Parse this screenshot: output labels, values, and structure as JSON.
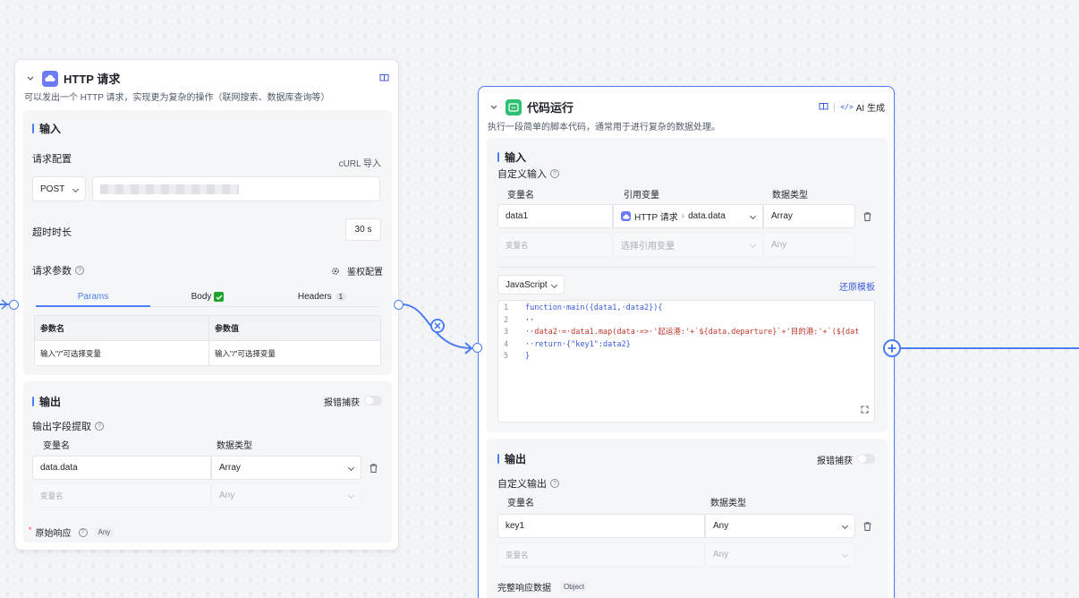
{
  "http_node": {
    "title": "HTTP 请求",
    "description": "可以发出一个 HTTP 请求，实现更为复杂的操作（联网搜索、数据库查询等）",
    "input": {
      "title": "输入",
      "request_config_label": "请求配置",
      "curl_import": "cURL 导入",
      "method": "POST",
      "timeout_label": "超时时长",
      "timeout_value": "30 s",
      "params_label": "请求参数",
      "auth_config": "鉴权配置",
      "tabs": {
        "params": "Params",
        "body": "Body",
        "headers": "Headers",
        "headers_count": "1"
      },
      "table": {
        "col_name": "参数名",
        "col_value": "参数值",
        "name_placeholder": "输入\"/\"可选择变量",
        "value_placeholder": "输入\"/\"可选择变量"
      }
    },
    "output": {
      "title": "输出",
      "error_catch": "报错捕获",
      "field_extract": "输出字段提取",
      "col_var": "变量名",
      "col_type": "数据类型",
      "row1_name": "data.data",
      "row1_type": "Array",
      "row2_name_placeholder": "变量名",
      "row2_type_placeholder": "Any",
      "raw_response": "原始响应",
      "raw_response_type": "Any"
    }
  },
  "code_node": {
    "title": "代码运行",
    "ai_generate": "AI 生成",
    "description": "执行一段简单的脚本代码，通常用于进行复杂的数据处理。",
    "input": {
      "title": "输入",
      "custom_input": "自定义输入",
      "col_var": "变量名",
      "col_ref": "引用变量",
      "col_type": "数据类型",
      "row1_name": "data1",
      "row1_ref_node": "HTTP 请求",
      "row1_ref_sep": "›",
      "row1_ref_path": "data.data",
      "row1_type": "Array",
      "row2_name_placeholder": "变量名",
      "row2_ref_placeholder": "选择引用变量",
      "row2_type_placeholder": "Any"
    },
    "language": "JavaScript",
    "restore_template": "还原模板",
    "code_lines": [
      {
        "n": "1",
        "t": "function·main({data1,·data2}){"
      },
      {
        "n": "2",
        "t": "··"
      },
      {
        "n": "3",
        "t": "··data2·=·data1.map(data·=>·'起运港:'+`${data.departure}`+'目的港:'+`(${dat"
      },
      {
        "n": "4",
        "t": "··return·{\"key1\":data2}"
      },
      {
        "n": "5",
        "t": "}"
      }
    ],
    "output": {
      "title": "输出",
      "error_catch": "报错捕获",
      "custom_output": "自定义输出",
      "col_var": "变量名",
      "col_type": "数据类型",
      "row1_name": "key1",
      "row1_type": "Any",
      "row2_name_placeholder": "变量名",
      "row2_type_placeholder": "Any",
      "full_response": "完整响应数据",
      "full_response_type": "Object"
    }
  },
  "colors": {
    "accent": "#4d7cf3",
    "http_icon_bg": "#6b7cf6",
    "code_icon_bg": "#2fbf71"
  }
}
